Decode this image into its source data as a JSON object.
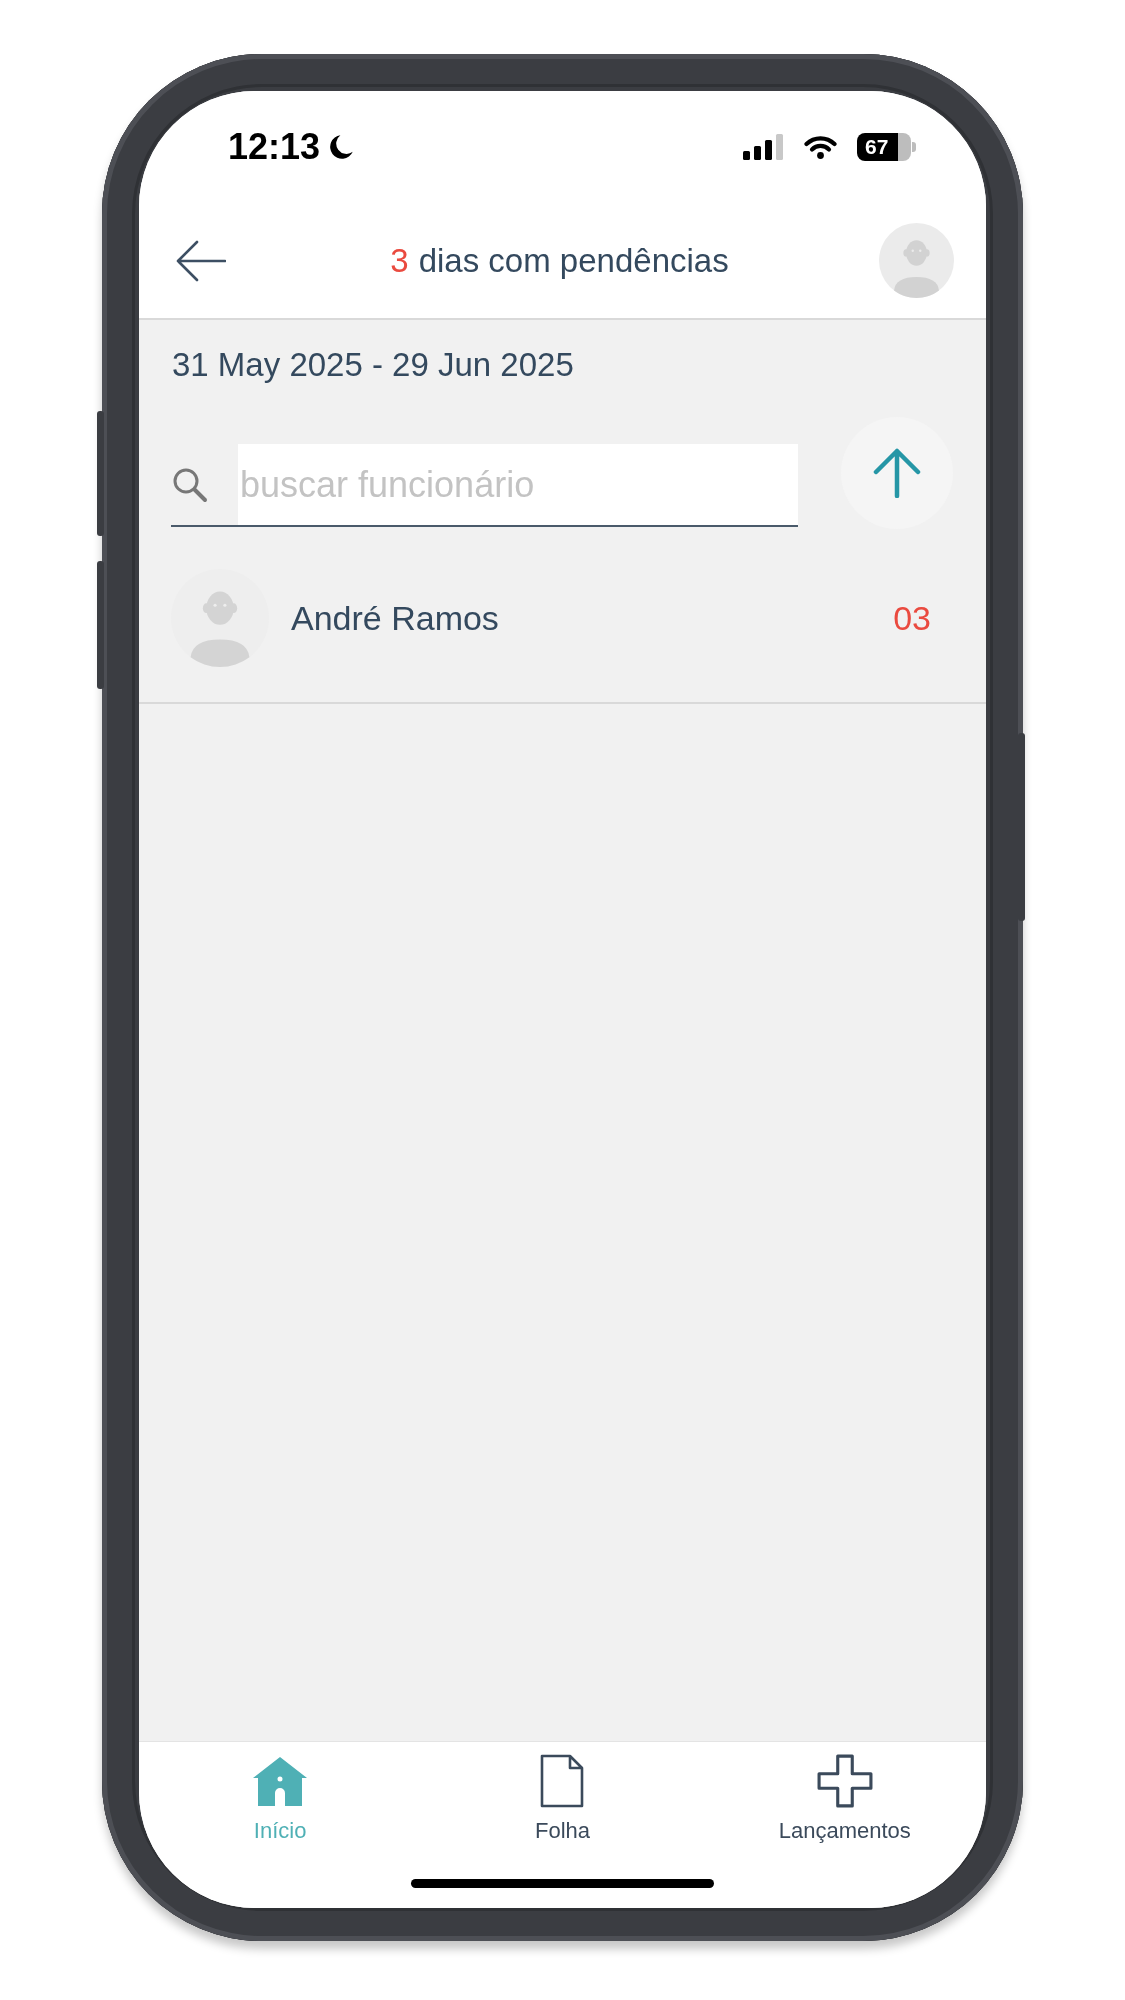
{
  "status_bar": {
    "time": "12:13",
    "battery": "67"
  },
  "header": {
    "count": "3",
    "title": "dias com pendências"
  },
  "period": "31 May 2025 - 29 Jun 2025",
  "search": {
    "placeholder": "buscar funcionário"
  },
  "employees": [
    {
      "name": "André Ramos",
      "pending": "03"
    }
  ],
  "bottom_nav": [
    {
      "kind": "home",
      "label": "Início",
      "selected": true
    },
    {
      "kind": "document",
      "label": "Folha",
      "selected": false
    },
    {
      "kind": "plus",
      "label": "Lançamentos",
      "selected": false
    }
  ]
}
